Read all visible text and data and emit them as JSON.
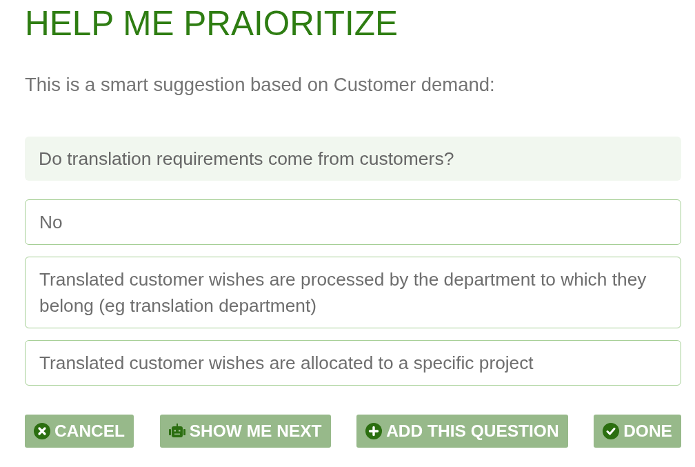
{
  "title": "HELP ME PRAIORITIZE",
  "intro": "This is a smart suggestion based on Customer demand:",
  "question": "Do translation requirements come from customers?",
  "answers": [
    "No",
    "Translated customer wishes are processed by the department to which they belong (eg translation department)",
    "Translated customer wishes are allocated to a specific project"
  ],
  "buttons": [
    {
      "kind": "cancel",
      "label": "CANCEL"
    },
    {
      "kind": "robot",
      "label": "SHOW ME NEXT"
    },
    {
      "kind": "add",
      "label": "ADD THIS QUESTION"
    },
    {
      "kind": "done",
      "label": "DONE"
    }
  ]
}
